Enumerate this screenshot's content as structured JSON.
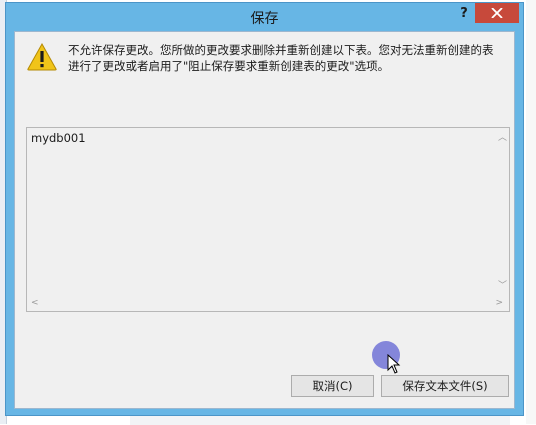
{
  "dialog": {
    "title": "保存",
    "help_label": "?",
    "message_line1": "不允许保存更改。您所做的更改要求删除并重新创建以下表。您对无法重新创建的表",
    "message_line2": "进行了更改或者启用了\"阻止保存要求重新创建表的更改\"选项。",
    "tables": [
      "mydb001"
    ],
    "cancel_label": "取消(C)",
    "save_text_label": "保存文本文件(S)"
  },
  "icons": {
    "warning": "warning-icon",
    "close": "close-icon",
    "scroll_up": "chevron-up-icon",
    "scroll_down": "chevron-down-icon",
    "scroll_left": "chevron-left-icon",
    "scroll_right": "chevron-right-icon",
    "cursor": "mouse-cursor-icon"
  },
  "colors": {
    "title_bar": "#67b6e5",
    "close_button": "#c7493b",
    "client_bg": "#f0f0f0",
    "cursor_highlight": "#7173d6"
  }
}
